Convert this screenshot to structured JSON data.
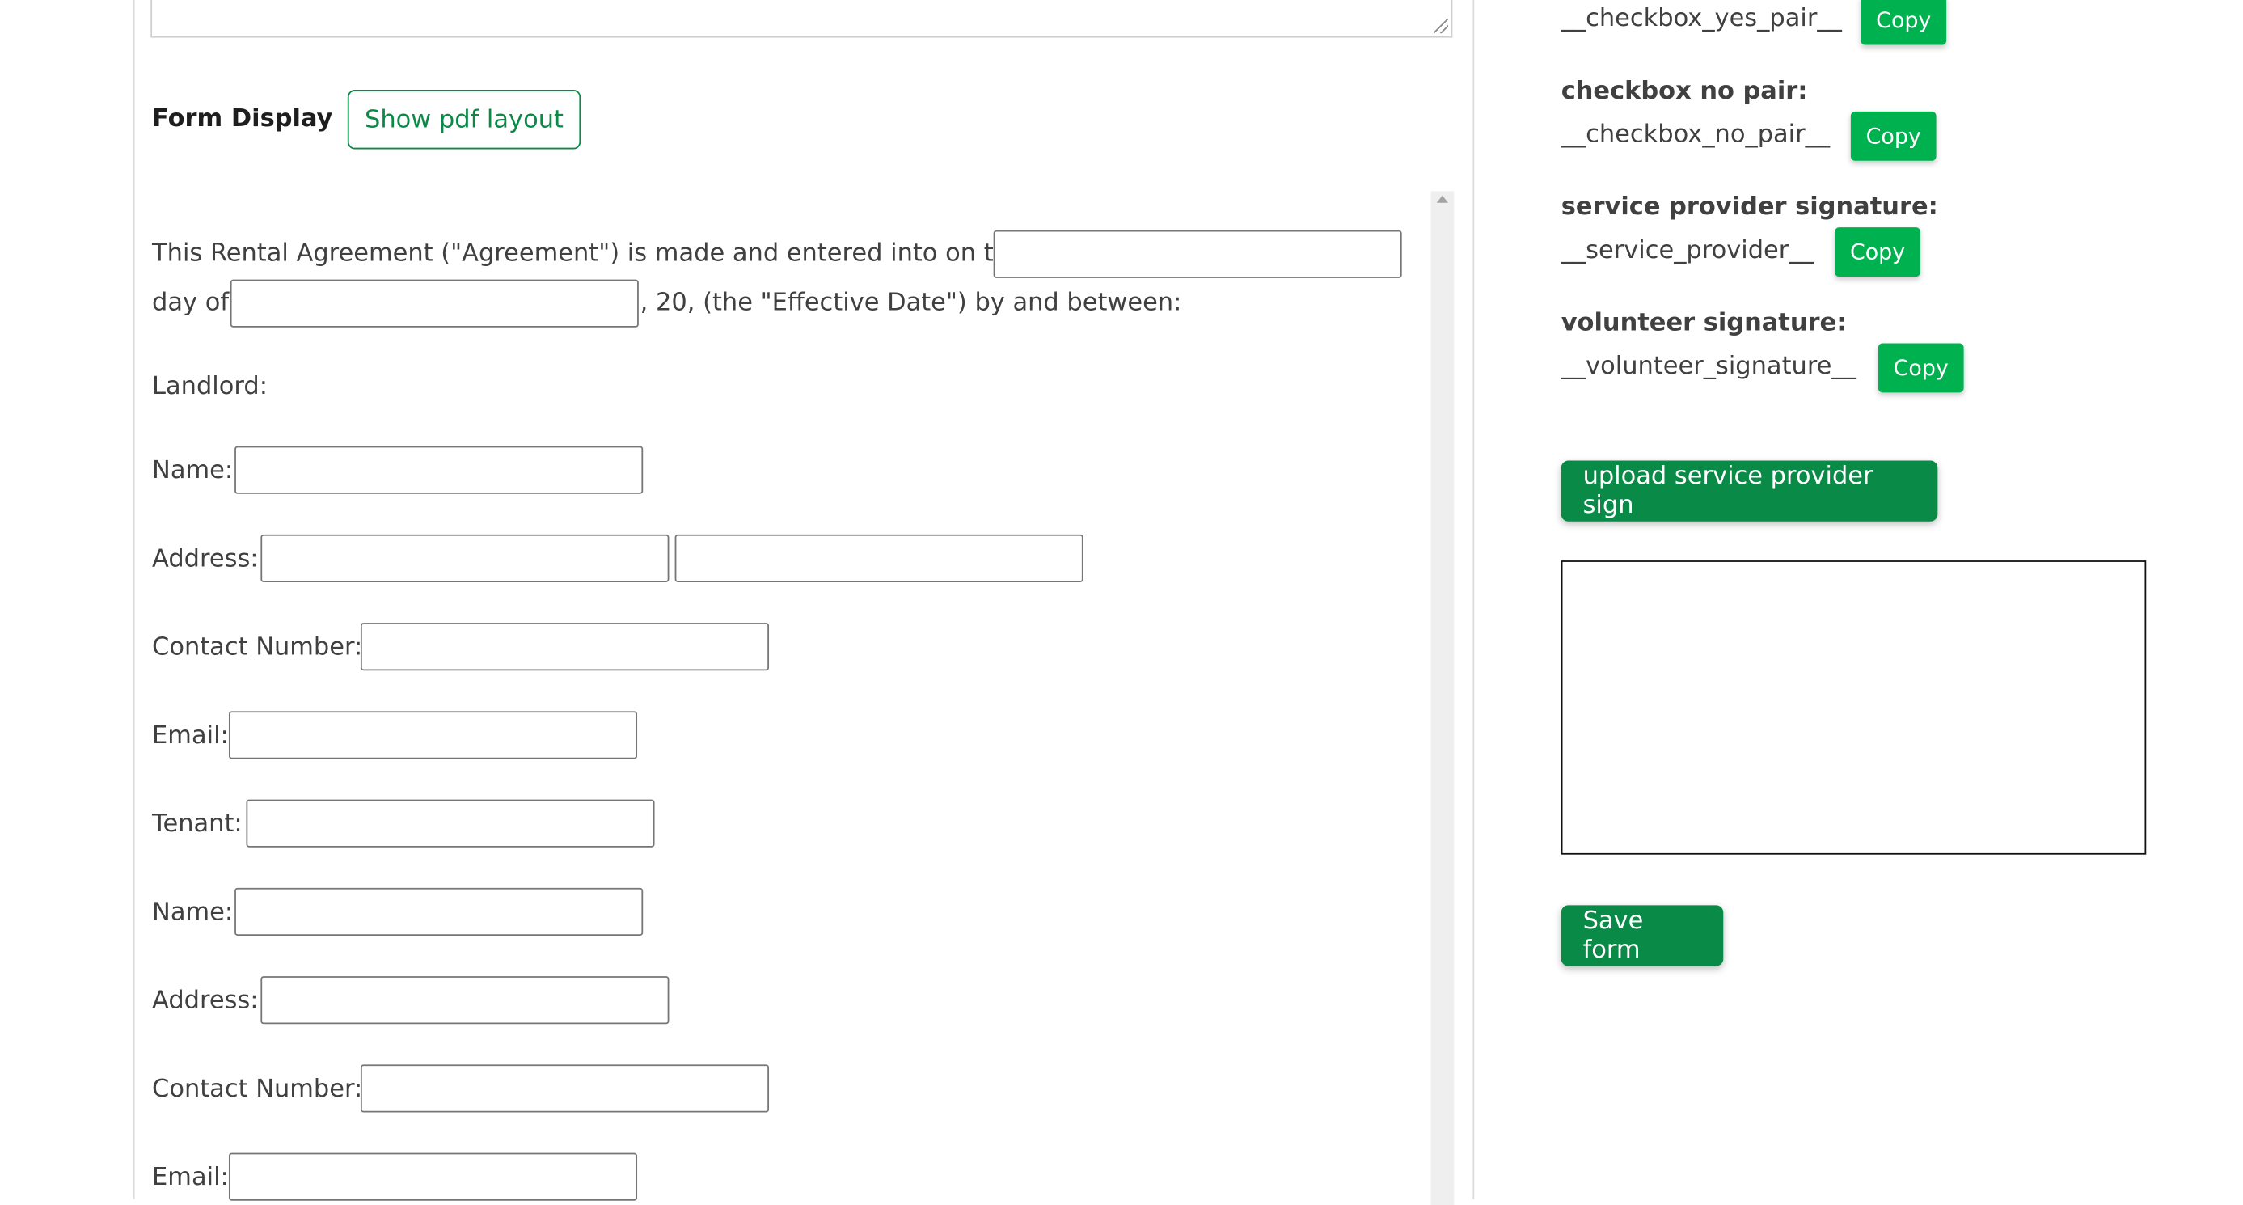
{
  "form_display": {
    "title": "Form Display",
    "show_pdf_button": "Show pdf layout"
  },
  "agreement": {
    "intro_prefix": "This Rental Agreement (\"Agreement\") is made and entered into on this",
    "day_of": "day of",
    "intro_suffix": ", 20, (the \"Effective Date\") by and between:",
    "landlord_heading": "Landlord:",
    "landlord": {
      "name_label": "Name:",
      "address_label": "Address:",
      "contact_label": "Contact Number:",
      "email_label": "Email:"
    },
    "tenant_label": "Tenant:",
    "tenant": {
      "name_label": "Name:",
      "address_label": "Address:",
      "contact_label": "Contact Number:",
      "email_label": "Email:"
    }
  },
  "tokens": {
    "checkbox_yes_pair": {
      "token": "__checkbox_yes_pair__",
      "copy": "Copy"
    },
    "checkbox_no_pair": {
      "label": "checkbox no pair:",
      "token": "__checkbox_no_pair__",
      "copy": "Copy"
    },
    "service_provider": {
      "label": "service provider signature:",
      "token": "__service_provider__",
      "copy": "Copy"
    },
    "volunteer": {
      "label": "volunteer signature:",
      "token": "__volunteer_signature__",
      "copy": "Copy"
    }
  },
  "actions": {
    "upload_sign": "upload service provider sign",
    "save_form": "Save form"
  },
  "colors": {
    "primary_green": "#0a8a47",
    "copy_green": "#00b14f"
  }
}
